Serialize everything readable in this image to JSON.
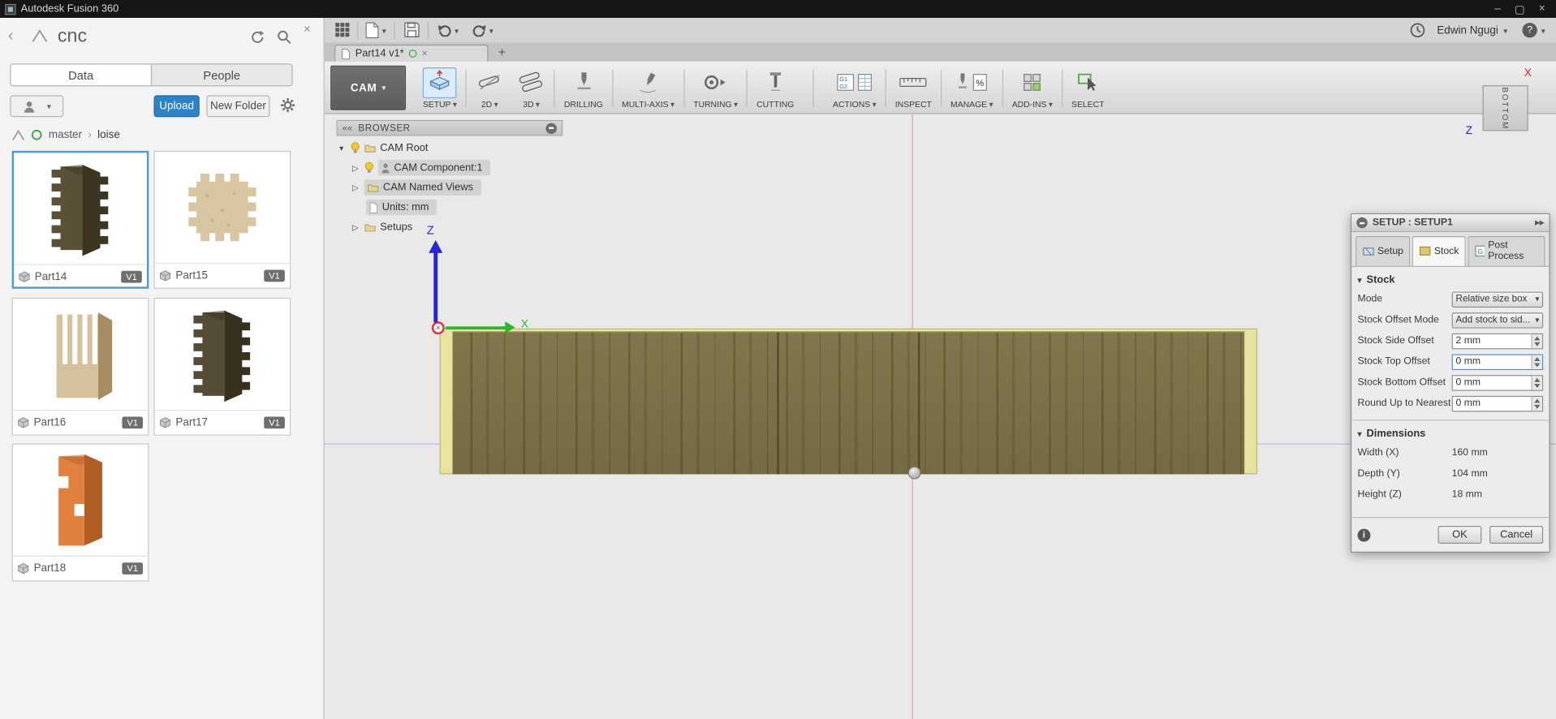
{
  "titlebar": {
    "app_title": "Autodesk Fusion 360"
  },
  "user_area": {
    "username": "Edwin Ngugi"
  },
  "colors": {
    "accent_blue": "#2d83c8",
    "selection_blue": "#4a9bd8",
    "wood_base": "#7b724a",
    "stock_yellow": "#e7e4a0"
  },
  "data_panel": {
    "title": "cnc",
    "tabs": [
      {
        "label": "Data"
      },
      {
        "label": "People"
      }
    ],
    "upload_label": "Upload",
    "new_folder_label": "New Folder",
    "breadcrumb": {
      "root": "master",
      "separator": "›",
      "current": "loise"
    },
    "parts": [
      {
        "name": "Part14",
        "version": "V1",
        "thumb_style": "--c1:#5a5138;--c2:#3b3522"
      },
      {
        "name": "Part15",
        "version": "V1",
        "thumb_style": "--c1:#d8c5a2;--c2:#b59c72"
      },
      {
        "name": "Part16",
        "version": "V1",
        "thumb_style": "--c1:#d5c19b;--c2:#a68c62"
      },
      {
        "name": "Part17",
        "version": "V1",
        "thumb_style": "--c1:#564c35;--c2:#38311f"
      },
      {
        "name": "Part18",
        "version": "V1",
        "thumb_style": "--c1:#e08140;--c2:#b15e24"
      }
    ]
  },
  "document_tab": {
    "label": "Part14 v1*"
  },
  "ribbon": {
    "workspace_label": "CAM",
    "groups": [
      {
        "label": "SETUP"
      },
      {
        "label": "2D"
      },
      {
        "label": "3D"
      },
      {
        "label": "DRILLING"
      },
      {
        "label": "MULTI-AXIS"
      },
      {
        "label": "TURNING"
      },
      {
        "label": "CUTTING"
      },
      {
        "label": "ACTIONS"
      },
      {
        "label": "INSPECT"
      },
      {
        "label": "MANAGE"
      },
      {
        "label": "ADD-INS"
      },
      {
        "label": "SELECT"
      }
    ]
  },
  "browser": {
    "title": "BROWSER",
    "items": [
      {
        "label": "CAM Root"
      },
      {
        "label": "CAM Component:1"
      },
      {
        "label": "CAM Named Views"
      },
      {
        "label": "Units: mm"
      },
      {
        "label": "Setups"
      }
    ]
  },
  "viewport": {
    "axis_x_label": "X",
    "axis_z_label": "Z",
    "viewcube_face": "BOTTOM",
    "viewcube_x": "X",
    "viewcube_z": "Z"
  },
  "setup_dialog": {
    "title": "SETUP : SETUP1",
    "tabs": [
      {
        "label": "Setup"
      },
      {
        "label": "Stock"
      },
      {
        "label": "Post Process"
      }
    ],
    "stock_section": {
      "title": "Stock",
      "mode": {
        "label": "Mode",
        "value": "Relative size box"
      },
      "offset_mode": {
        "label": "Stock Offset Mode",
        "value": "Add stock to sid..."
      },
      "side_offset": {
        "label": "Stock Side Offset",
        "value": "2 mm"
      },
      "top_offset": {
        "label": "Stock Top Offset",
        "value": "0 mm"
      },
      "bottom_offset": {
        "label": "Stock Bottom Offset",
        "value": "0 mm"
      },
      "round_up": {
        "label": "Round Up to Nearest",
        "value": "0 mm"
      }
    },
    "dimensions_section": {
      "title": "Dimensions",
      "width": {
        "label": "Width (X)",
        "value": "160 mm"
      },
      "depth": {
        "label": "Depth (Y)",
        "value": "104 mm"
      },
      "height": {
        "label": "Height (Z)",
        "value": "18 mm"
      }
    },
    "ok_label": "OK",
    "cancel_label": "Cancel"
  }
}
